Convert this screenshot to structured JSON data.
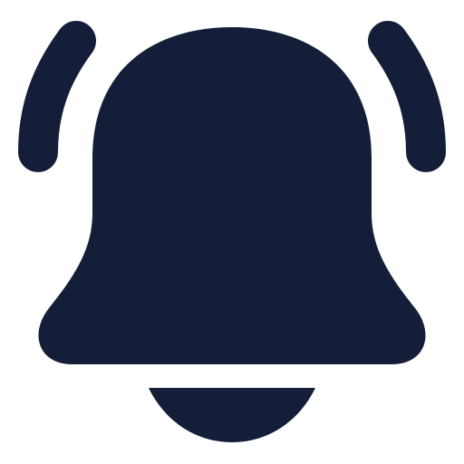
{
  "icon": {
    "name": "bell-ringing-icon",
    "color": "#151e38",
    "background": "#ffffff"
  }
}
